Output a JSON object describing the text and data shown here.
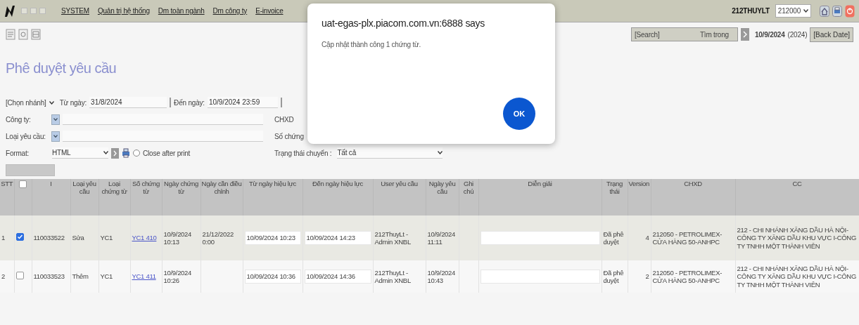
{
  "menubar": {
    "items": [
      "SYSTEM",
      "Quản trị hệ thống",
      "Dm toàn ngành",
      "Dm công ty",
      "E-invoice"
    ],
    "user": "212THUYLT",
    "branch": "212000"
  },
  "toolbar": {
    "search": "[Search]",
    "scope": "Tìm trong",
    "date": "10/9/2024",
    "year": "(2024)",
    "back_date": "[Back Date]"
  },
  "page_title": "Phê duyệt yêu cầu",
  "filters": {
    "branch_select": "[Chọn nhánh]",
    "from_label": "Từ ngày:",
    "from_value": "31/8/2024",
    "to_label": "Đến ngày:",
    "to_value": "10/9/2024 23:59",
    "company_label": "Công ty:",
    "request_type_label": "Loại yêu cầu:",
    "format_label": "Format:",
    "format_value": "HTML",
    "close_after_print": {
      "label": "Close after print",
      "checked": false
    },
    "chxd_label": "CHXD",
    "doc_no_label": "Số chứng",
    "transfer_label": "Trạng thái chuyển :",
    "transfer_value": "Tất cả"
  },
  "action_button": {
    "disabled": true
  },
  "table": {
    "select_all_checked": false,
    "columns": [
      "STT",
      "",
      "I",
      "Loại yêu cầu",
      "Loại chứng từ",
      "Số chứng từ",
      "Ngày chứng từ",
      "Ngày cần điều chỉnh",
      "Từ ngày hiệu lực",
      "Đến ngày hiệu lực",
      "User yêu cầu",
      "Ngày yêu cầu",
      "Ghi chú",
      "Diễn giải",
      "Trạng thái",
      "Version",
      "CHXD",
      "CC"
    ],
    "rows": [
      {
        "stt": "1",
        "selected": true,
        "id": "110033522",
        "type": "Sửa",
        "doc_type": "YC1",
        "doc_no": "YC1 410",
        "doc_date": "10/9/2024 10:13",
        "adjust_date": "21/12/2022 0:00",
        "from": "10/09/2024 10:23",
        "to": "10/09/2024 14:23",
        "user": "212ThuyLt - Admin XNBL",
        "req_date": "10/9/2024 11:11",
        "status": "Đã phê duyệt",
        "version": "4",
        "chxd": "212050 - PETROLIMEX-CỬA HÀNG 50-ANHPC",
        "cc": "212 - CHI NHÁNH XĂNG DẦU HÀ NỘI-CÔNG TY XĂNG DẦU KHU VỰC I-CÔNG TY TNHH MỘT THÀNH VIÊN"
      },
      {
        "stt": "2",
        "selected": false,
        "id": "110033523",
        "type": "Thêm",
        "doc_type": "YC1",
        "doc_no": "YC1 411",
        "doc_date": "10/9/2024 10:26",
        "adjust_date": "",
        "from": "10/09/2024 10:36",
        "to": "10/09/2024 14:36",
        "user": "212ThuyLt - Admin XNBL",
        "req_date": "10/9/2024 10:43",
        "status": "Đã phê duyệt",
        "version": "2",
        "chxd": "212050 - PETROLIMEX-CỬA HÀNG 50-ANHPC",
        "cc": "212 - CHI NHÁNH XĂNG DẦU HÀ NỘI-CÔNG TY XĂNG DẦU KHU VỰC I-CÔNG TY TNHH MỘT THÀNH VIÊN"
      }
    ]
  },
  "dialog": {
    "title": "uat-egas-plx.piacom.com.vn:6888 says",
    "message": "Cập nhật thành công 1 chứng từ.",
    "ok": "OK"
  }
}
